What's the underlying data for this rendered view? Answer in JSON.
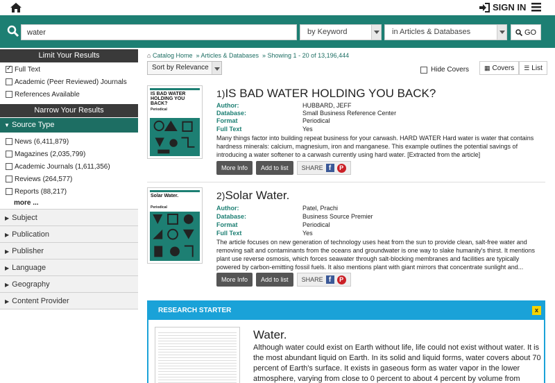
{
  "header": {
    "signin_label": "SIGN IN"
  },
  "search": {
    "query": "water",
    "field_option": "by Keyword",
    "scope_option": "in Articles & Databases",
    "go_label": "GO"
  },
  "sidebar": {
    "limit_header": "Limit Your Results",
    "limits": [
      {
        "label": "Full Text",
        "checked": true
      },
      {
        "label": "Academic (Peer Reviewed) Journals",
        "checked": false
      },
      {
        "label": "References Available",
        "checked": false
      }
    ],
    "narrow_header": "Narrow Your Results",
    "source_type_header": "Source Type",
    "source_types": [
      {
        "label": "News (6,411,879)"
      },
      {
        "label": "Magazines (2,035,799)"
      },
      {
        "label": "Academic Journals (1,611,356)"
      },
      {
        "label": "Reviews (264,577)"
      },
      {
        "label": "Reports (88,217)"
      }
    ],
    "more_label": "more ...",
    "collapsed_facets": [
      "Subject",
      "Publication",
      "Publisher",
      "Language",
      "Geography",
      "Content Provider"
    ]
  },
  "breadcrumb": {
    "home": "Catalog Home",
    "section": "» Articles & Databases",
    "showing": "» Showing 1 - 20 of 13,196,444"
  },
  "toolbar": {
    "sort_label": "Sort by Relevance",
    "hide_covers_label": "Hide Covers",
    "covers_label": "Covers",
    "list_label": "List"
  },
  "results": [
    {
      "number": "1)",
      "title": "IS BAD WATER HOLDING YOU BACK?",
      "cover_title": "IS BAD WATER HOLDING YOU BACK?",
      "cover_type": "Periodical",
      "author_label": "Author:",
      "author": "HUBBARD, JEFF",
      "database_label": "Database:",
      "database": "Small Business Reference Center",
      "format_label": "Format",
      "format": "Periodical",
      "fulltext_label": "Full Text",
      "fulltext": "Yes",
      "abstract": "Many things factor into building repeat business for your carwash. HARD WATER Hard water is water that contains hardness minerals: calcium, magnesium, iron and manganese. This example outlines the potential savings of introducing a water softener to a carwash currently using hard water. [Extracted from the article]",
      "more_info": "More Info",
      "add_to_list": "Add to list",
      "share": "SHARE"
    },
    {
      "number": "2)",
      "title": "Solar Water.",
      "cover_title": "Solar Water.",
      "cover_type": "Periodical",
      "author_label": "Author:",
      "author": "Patel, Prachi",
      "database_label": "Database:",
      "database": "Business Source Premier",
      "format_label": "Format",
      "format": "Periodical",
      "fulltext_label": "Full Text",
      "fulltext": "Yes",
      "abstract": "The article focuses on new generation of technology uses heat from the sun to provide clean, salt-free water and removing salt and contaminants from the oceans and groundwater is one way to slake humanity's thirst. It mentions plant use reverse osmosis, which forces seawater through salt-blocking membranes and facilities are typically powered by carbon-emitting fossil fuels. It also mentions plant with giant mirrors that concentrate sunlight and...",
      "more_info": "More Info",
      "add_to_list": "Add to list",
      "share": "SHARE"
    }
  ],
  "research_starter": {
    "header": "RESEARCH STARTER",
    "close": "x",
    "title": "Water.",
    "body": "Although water could exist on Earth without life, life could not exist without water. It is the most abundant liquid on Earth. In its solid and liquid forms, water covers about 70 percent of Earth's surface. It exists in gaseous form as water vapor in the lower atmosphere, varying from close to 0 percent to about 4 percent by volume from region to region. Water"
  },
  "colors": {
    "teal": "#1d7f73",
    "dark": "#3a3a3a",
    "starter_blue": "#1aa2d8"
  }
}
